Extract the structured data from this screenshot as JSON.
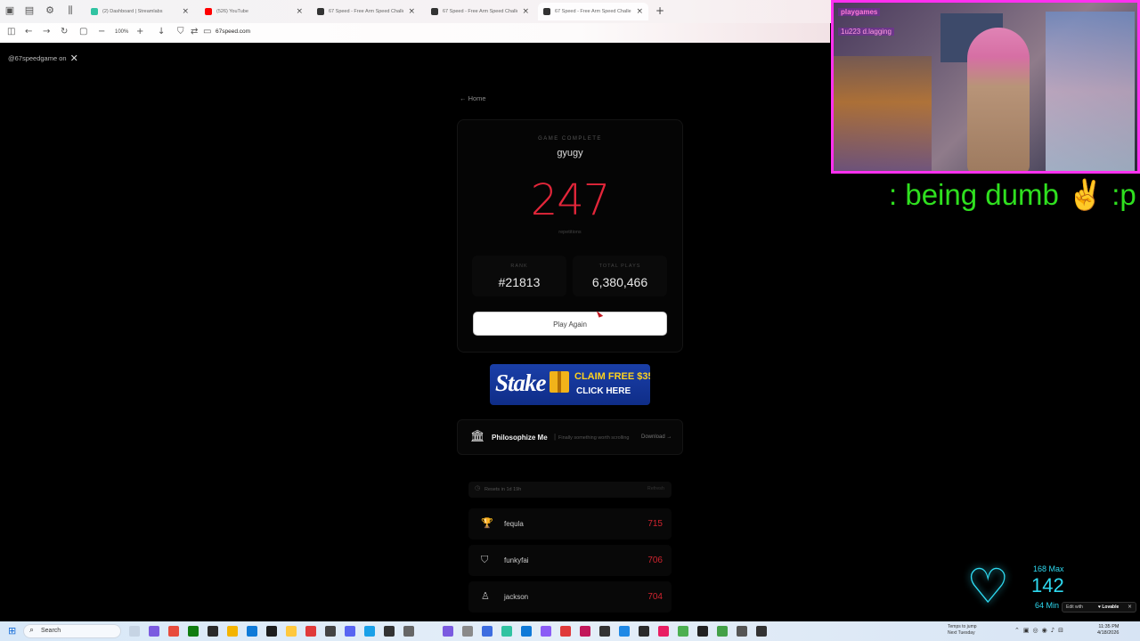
{
  "browser": {
    "tabs": [
      {
        "label": "(2) Dashboard | Streamlabs",
        "active": false,
        "favicon_color": "#31c3a2"
      },
      {
        "label": "(526) YouTube",
        "active": false,
        "favicon_color": "#ff0000"
      },
      {
        "label": "67 Speed - Free Arm Speed Challen",
        "active": false,
        "favicon_color": "#333333"
      },
      {
        "label": "67 Speed - Free Arm Speed Challen",
        "active": false,
        "favicon_color": "#333333"
      },
      {
        "label": "67 Speed - Free Arm Speed Challen",
        "active": true,
        "favicon_color": "#333333"
      }
    ],
    "zoom": "100%",
    "url": "67speed.com"
  },
  "overlay": {
    "handle": "@67speedgame on"
  },
  "page": {
    "home_link": "← Home",
    "status_label": "GAME COMPLETE",
    "player_name": "gyugy",
    "score": "247",
    "score_unit": "repetitions",
    "rank_label": "RANK",
    "rank_value": "#21813",
    "plays_label": "TOTAL PLAYS",
    "plays_value": "6,380,466",
    "play_again": "Play Again"
  },
  "ad": {
    "brand": "Stake",
    "claim": "CLAIM FREE $35",
    "cta": "CLICK HERE"
  },
  "promo": {
    "name": "Philosophize Me",
    "separator": "|",
    "tagline": "Finally something worth scrolling",
    "download": "Download →"
  },
  "leaderboard": {
    "reset_text": "Resets in 1d 19h",
    "refresh": "Refresh",
    "rows": [
      {
        "name": "fequla",
        "score": "715",
        "icon": "trophy-icon",
        "icon_color": "#e3263a"
      },
      {
        "name": "funkyfai",
        "score": "706",
        "icon": "medal-icon",
        "icon_color": "#bbbbbb"
      },
      {
        "name": "jackson",
        "score": "704",
        "icon": "award-icon",
        "icon_color": "#bbbbbb"
      }
    ]
  },
  "stream": {
    "cam_label_1": "playgames",
    "cam_label_2": "1u223 d.lagging",
    "ticker": ": being dumb ✌ :p",
    "heart_rate": {
      "max_label": "168 Max",
      "current": "142",
      "min_label": "64 Min"
    },
    "lovable": {
      "edit": "Edit with",
      "brand": "♥ Lovable"
    }
  },
  "taskbar": {
    "search": "Search",
    "weather_line1": "Temps to jump",
    "weather_line2": "Next Tuesday",
    "time": "11:35 PM",
    "date": "4/18/2026"
  },
  "colors": {
    "accent_red": "#e3263a",
    "ticker_green": "#2fe01f",
    "heart_cyan": "#2ed9f0",
    "cam_border": "#ff30f0"
  }
}
